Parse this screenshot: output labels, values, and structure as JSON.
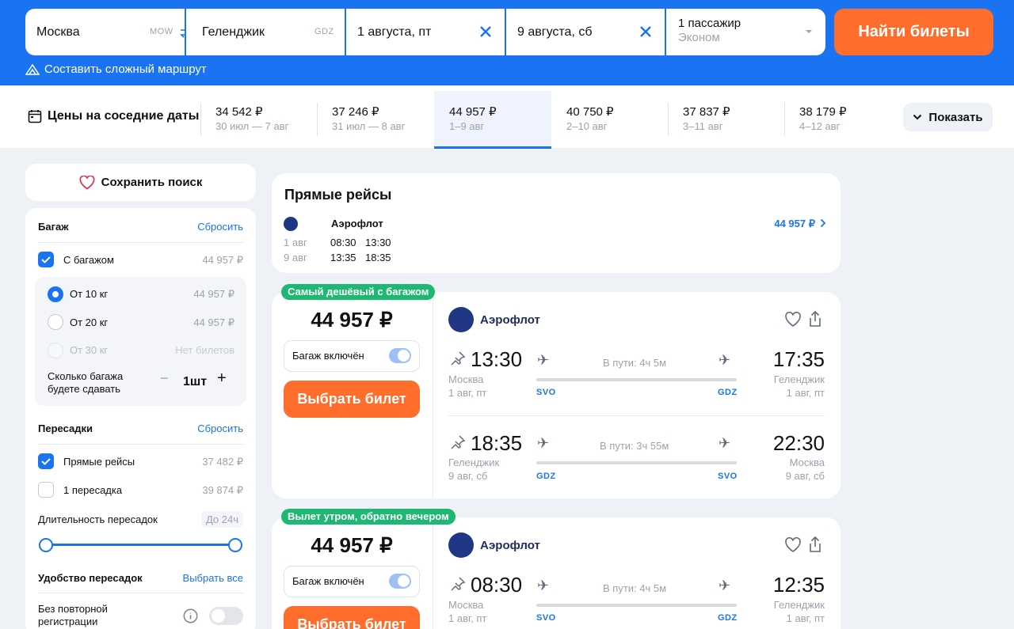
{
  "search": {
    "from": "Москва",
    "from_code": "MOW",
    "to": "Геленджик",
    "to_code": "GDZ",
    "date_there": "1 августа, пт",
    "date_back": "9 августа, сб",
    "passengers": "1 пассажир",
    "class": "Эконом",
    "find_label": "Найти билеты",
    "complex_route": "Составить сложный маршрут"
  },
  "dates_strip": {
    "title": "Цены на соседние даты",
    "cells": [
      {
        "price": "34 542 ₽",
        "range": "30 июл — 7 авг"
      },
      {
        "price": "37 246 ₽",
        "range": "31 июл — 8 авг"
      },
      {
        "price": "44 957 ₽",
        "range": "1–9 авг"
      },
      {
        "price": "40 750 ₽",
        "range": "2–10 авг"
      },
      {
        "price": "37 837 ₽",
        "range": "3–11 авг"
      },
      {
        "price": "38 179 ₽",
        "range": "4–12 авг"
      }
    ],
    "show_label": "Показать"
  },
  "sidebar": {
    "save_search": "Сохранить поиск",
    "baggage": {
      "title": "Багаж",
      "reset": "Сбросить",
      "with_baggage": "С багажом",
      "with_baggage_price": "44 957 ₽",
      "options": [
        {
          "label": "От 10 кг",
          "price": "44 957 ₽"
        },
        {
          "label": "От 20 кг",
          "price": "44 957 ₽"
        },
        {
          "label": "От 30 кг",
          "price": "Нет билетов"
        }
      ],
      "count_label": "Сколько багажа будете сдавать",
      "count_value": "1шт"
    },
    "transfers": {
      "title": "Пересадки",
      "reset": "Сбросить",
      "direct": "Прямые рейсы",
      "direct_price": "37 482 ₽",
      "one": "1 пересадка",
      "one_price": "39 874 ₽",
      "duration_label": "Длительность пересадок",
      "duration_value": "До 24ч"
    },
    "comfort": {
      "title": "Удобство пересадок",
      "select_all": "Выбрать все",
      "no_recheck": "Без повторной регистрации"
    }
  },
  "direct_flights": {
    "title": "Прямые рейсы",
    "airline": "Аэрофлот",
    "price": "44 957 ₽",
    "rows": [
      {
        "date": "1 авг",
        "dep": "08:30",
        "arr": "13:30"
      },
      {
        "date": "9 авг",
        "dep": "13:35",
        "arr": "18:35"
      }
    ]
  },
  "tickets": [
    {
      "tag": "Самый дешёвый с багажом",
      "price": "44 957 ₽",
      "baggage": "Багаж включён",
      "select": "Выбрать билет",
      "airline": "Аэрофлот",
      "legs": [
        {
          "dep_time": "13:30",
          "dep_city": "Москва",
          "dep_date": "1 авг, пт",
          "duration": "В пути: 4ч 5м",
          "from": "SVO",
          "to": "GDZ",
          "arr_time": "17:35",
          "arr_city": "Геленджик",
          "arr_date": "1 авг, пт"
        },
        {
          "dep_time": "18:35",
          "dep_city": "Геленджик",
          "dep_date": "9 авг, сб",
          "duration": "В пути: 3ч 55м",
          "from": "GDZ",
          "to": "SVO",
          "arr_time": "22:30",
          "arr_city": "Москва",
          "arr_date": "9 авг, сб"
        }
      ]
    },
    {
      "tag": "Вылет утром, обратно вечером",
      "price": "44 957 ₽",
      "baggage": "Багаж включён",
      "select": "Выбрать билет",
      "airline": "Аэрофлот",
      "legs": [
        {
          "dep_time": "08:30",
          "dep_city": "Москва",
          "dep_date": "1 авг, пт",
          "duration": "В пути: 4ч 5м",
          "from": "SVO",
          "to": "GDZ",
          "arr_time": "12:35",
          "arr_city": "Геленджик",
          "arr_date": "1 авг, пт"
        }
      ]
    }
  ],
  "colors": {
    "brand": "#1a73f0",
    "accent": "#ff6d2d",
    "tag": "#1fb873"
  }
}
